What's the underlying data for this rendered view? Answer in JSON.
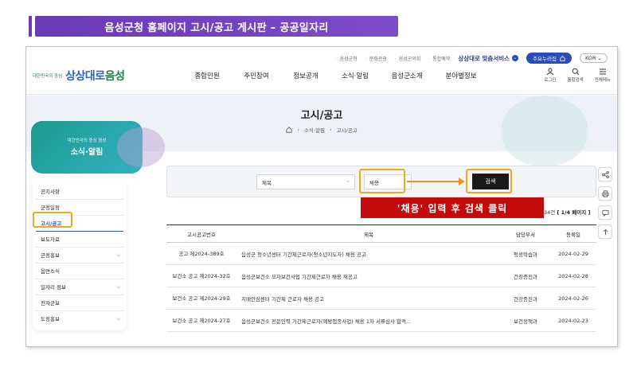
{
  "banner": {
    "text": "음성군청 홈페이지 고시/공고 게시판 – 공공일자리"
  },
  "util": {
    "links": [
      "음성군청",
      "문화관광",
      "음성군의회",
      "통합예약"
    ],
    "service": "상상대로 맞춤서비스",
    "my_btn": "주요누리집",
    "lang": "KOR"
  },
  "logo": {
    "small": "대한민국의 중심",
    "main_a": "상상대로",
    "main_b": "음성"
  },
  "gnb": [
    "종합민원",
    "주민참여",
    "정보공개",
    "소식·알림",
    "음성군소개",
    "분야별정보"
  ],
  "header_icons": {
    "login": "로그인",
    "search": "통합검색",
    "menu": "전체메뉴"
  },
  "page": {
    "title": "고시/공고",
    "breadcrumb": [
      "소식·알림",
      "고시/공고"
    ]
  },
  "side": {
    "small": "대한민국의 중심 음성",
    "title": "소식·알림",
    "items": [
      {
        "label": "공지사항",
        "chev": ""
      },
      {
        "label": "군정일정",
        "chev": ""
      },
      {
        "label": "고시/공고",
        "chev": ""
      },
      {
        "label": "보도자료",
        "chev": ""
      },
      {
        "label": "군정홍보",
        "chev": "⌵"
      },
      {
        "label": "읍면소식",
        "chev": ""
      },
      {
        "label": "일자리 정보",
        "chev": "⌵"
      },
      {
        "label": "전자군보",
        "chev": ""
      },
      {
        "label": "도정홍보",
        "chev": "⌵"
      }
    ]
  },
  "search": {
    "select_value": "제목",
    "input_value": "채용",
    "button_label": "검색"
  },
  "callout": {
    "text": "'채용' 입력 후 검색 클릭"
  },
  "count": {
    "prefix": "34건",
    "page": "[ 1/4 페이지 ]"
  },
  "table": {
    "headers": [
      "고시공고번호",
      "제목",
      "담당부서",
      "등록일"
    ],
    "rows": [
      {
        "no": "공고 제2024-389호",
        "title": "음성군 청소년센터 기간제근로자(청소년지도자) 채용 공고",
        "dept": "평생학습과",
        "date": "2024-02-29"
      },
      {
        "no": "보건소 공고 제2024-32호",
        "title": "음성군보건소 모자보건사업 기간제근로자 채용 재공고",
        "dept": "건강증진과",
        "date": "2024-02-28"
      },
      {
        "no": "보건소 공고 제2024-29호",
        "title": "치매안심센터 기간제 근로자 채용 공고",
        "dept": "건강증진과",
        "date": "2024-02-26"
      },
      {
        "no": "보건소 공고 제2024-27호",
        "title": "음성군보건소 전문인력 기간제근로자(예방접종사업) 채용 1차 서류심사 합격...",
        "dept": "보건정책과",
        "date": "2024-02-23"
      }
    ]
  }
}
